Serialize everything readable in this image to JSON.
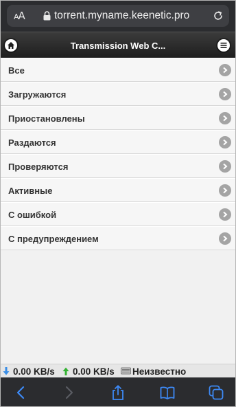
{
  "browser": {
    "text_size_small": "A",
    "text_size_large": "A",
    "url": "torrent.myname.keenetic.pro"
  },
  "header": {
    "title": "Transmission Web C..."
  },
  "filters": [
    {
      "label": "Все"
    },
    {
      "label": "Загружаются"
    },
    {
      "label": "Приостановлены"
    },
    {
      "label": "Раздаются"
    },
    {
      "label": "Проверяются"
    },
    {
      "label": "Активные"
    },
    {
      "label": "С ошибкой"
    },
    {
      "label": "С предупреждением"
    }
  ],
  "status": {
    "download_speed": "0.00 KB/s",
    "upload_speed": "0.00 KB/s",
    "disk": "Неизвестно"
  },
  "colors": {
    "download_arrow": "#3a8ee6",
    "upload_arrow": "#34b233",
    "safari_blue": "#3d8af7"
  }
}
